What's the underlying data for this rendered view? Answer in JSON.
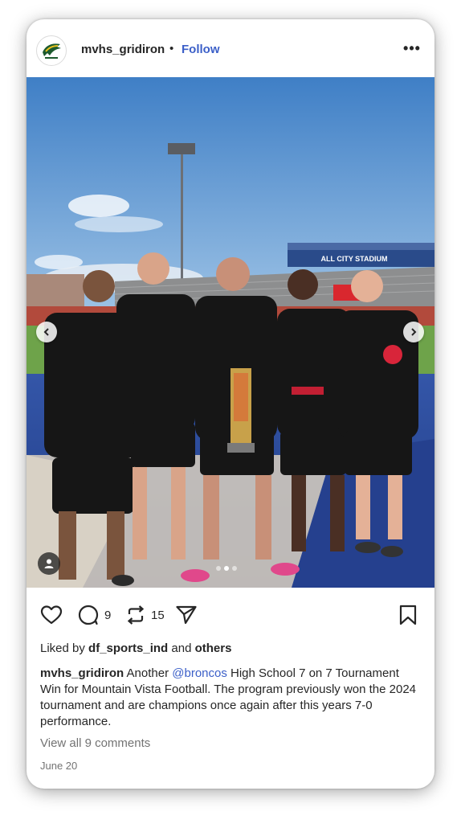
{
  "post": {
    "username": "mvhs_gridiron",
    "separator": "•",
    "follow_label": "Follow",
    "more_label": "•••",
    "avatar_icon": "broncos-logo",
    "image": {
      "current_index": 2,
      "total": 3,
      "banner_text": "ALL CITY STADIUM"
    },
    "comments_count": "9",
    "reposts_count": "15",
    "liked_by": {
      "prefix": "Liked by",
      "user": "df_sports_ind",
      "and": "and",
      "others": "others"
    },
    "caption": {
      "user": "mvhs_gridiron",
      "pre": "Another",
      "mention": "@broncos",
      "text": "High School 7 on 7 Tournament Win for Mountain Vista Football. The program previously won the 2024 tournament and are champions once again after this years 7-0 performance."
    },
    "view_comments": "View all 9 comments",
    "date": "June 20"
  },
  "colors": {
    "link": "#3b5fc8",
    "text": "#262626",
    "muted": "#737373",
    "sky": "#4a86c9",
    "turf_blue": "#27469a"
  },
  "icons": [
    "heart-icon",
    "comment-icon",
    "repost-icon",
    "share-icon",
    "bookmark-icon",
    "chevron-left-icon",
    "chevron-right-icon",
    "user-tag-icon",
    "more-icon"
  ]
}
